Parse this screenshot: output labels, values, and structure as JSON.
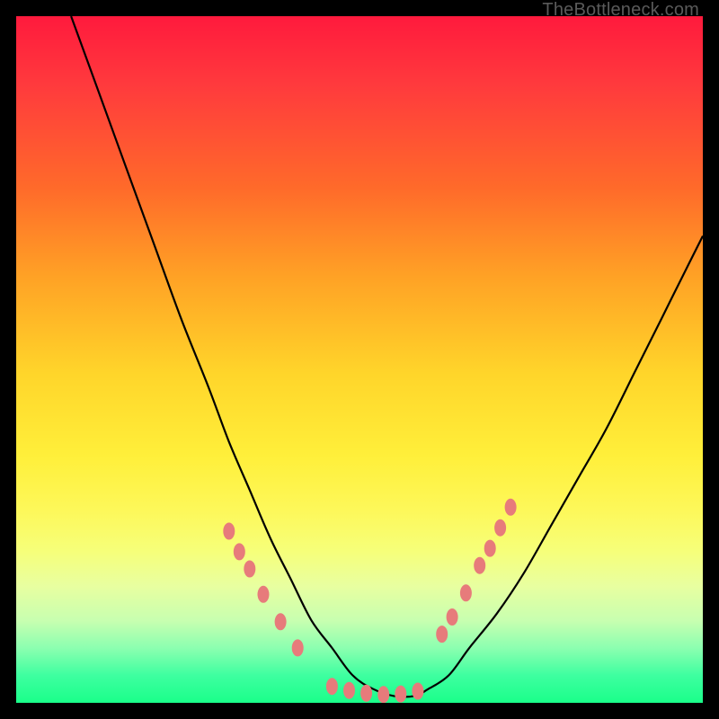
{
  "attribution": "TheBottleneck.com",
  "chart_data": {
    "type": "line",
    "title": "",
    "xlabel": "",
    "ylabel": "",
    "xlim": [
      0,
      100
    ],
    "ylim": [
      0,
      100
    ],
    "series": [
      {
        "name": "bottleneck-curve",
        "x": [
          8,
          12,
          16,
          20,
          24,
          28,
          31,
          34,
          37,
          40,
          43,
          46,
          49,
          52,
          55,
          58,
          60,
          63,
          66,
          70,
          74,
          78,
          82,
          86,
          90,
          94,
          98,
          100
        ],
        "y": [
          100,
          89,
          78,
          67,
          56,
          46,
          38,
          31,
          24,
          18,
          12,
          8,
          4,
          2,
          1,
          1,
          2,
          4,
          8,
          13,
          19,
          26,
          33,
          40,
          48,
          56,
          64,
          68
        ]
      }
    ],
    "markers": [
      {
        "name": "left-cluster",
        "x": [
          31.0,
          32.5,
          34.0,
          36.0,
          38.5,
          41.0
        ],
        "y": [
          25.0,
          22.0,
          19.5,
          15.8,
          11.8,
          8.0
        ]
      },
      {
        "name": "bottom-cluster",
        "x": [
          46.0,
          48.5,
          51.0,
          53.5,
          56.0,
          58.5
        ],
        "y": [
          2.4,
          1.8,
          1.4,
          1.2,
          1.3,
          1.7
        ]
      },
      {
        "name": "right-cluster",
        "x": [
          62.0,
          63.5,
          65.5,
          67.5,
          69.0,
          70.5,
          72.0
        ],
        "y": [
          10.0,
          12.5,
          16.0,
          20.0,
          22.5,
          25.5,
          28.5
        ]
      }
    ],
    "colors": {
      "curve": "#000000",
      "marker": "#e77b7b",
      "gradient_top": "#ff1a3d",
      "gradient_bottom": "#1aff8a"
    }
  }
}
